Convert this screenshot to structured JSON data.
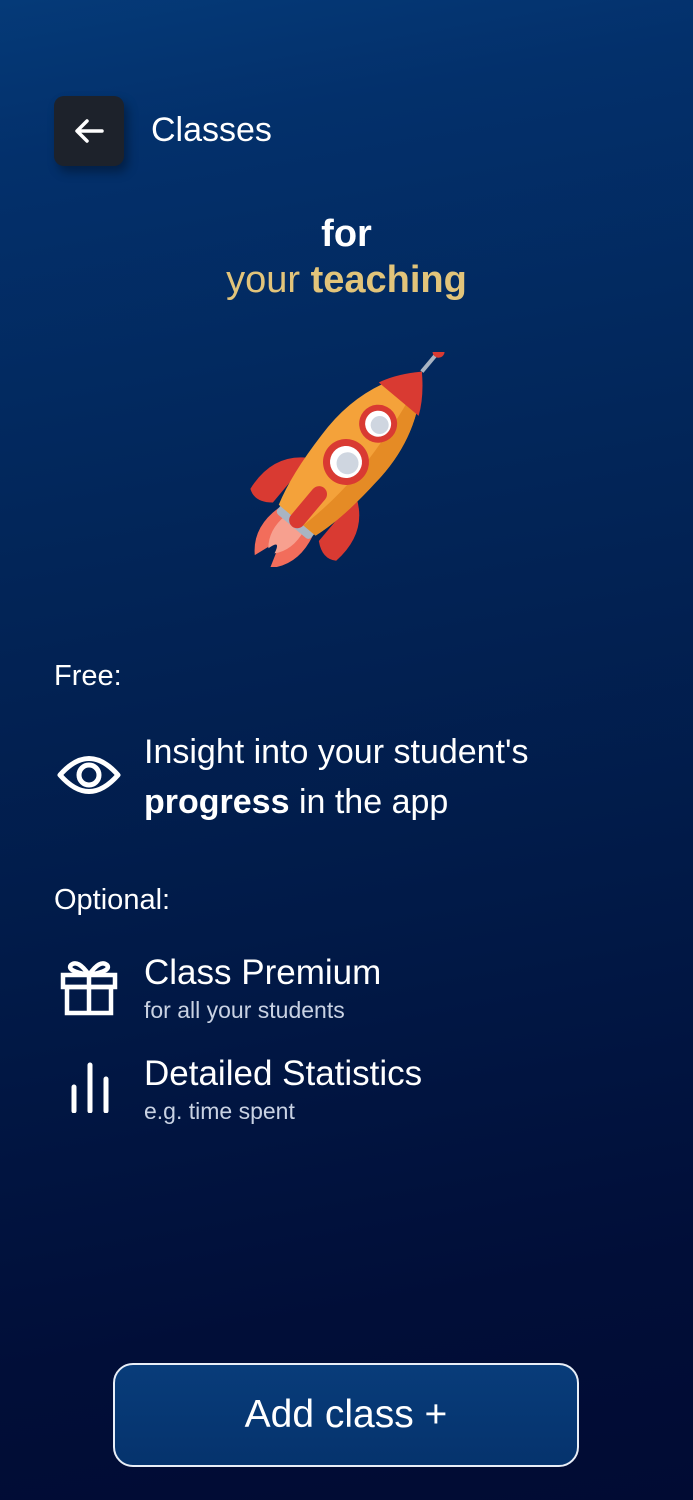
{
  "header": {
    "title": "Classes",
    "back_icon": "arrow-left-icon"
  },
  "hero": {
    "line1": "for",
    "line2_plain": "your ",
    "line2_bold": "teaching",
    "illustration": "rocket-illustration"
  },
  "free": {
    "label": "Free:",
    "feature": {
      "icon": "eye-icon",
      "text_line1": "Insight into your student's",
      "text_bold": "progress",
      "text_rest": " in the app"
    }
  },
  "optional": {
    "label": "Optional:",
    "items": [
      {
        "icon": "gift-icon",
        "title": "Class Premium",
        "subtitle": "for all your students"
      },
      {
        "icon": "bar-chart-icon",
        "title": "Detailed Statistics",
        "subtitle": "e.g. time spent"
      }
    ]
  },
  "cta": {
    "label": "Add class +"
  },
  "colors": {
    "accent_gold": "#e2c47a",
    "background_top": "#053a78",
    "background_bottom": "#010b33"
  }
}
